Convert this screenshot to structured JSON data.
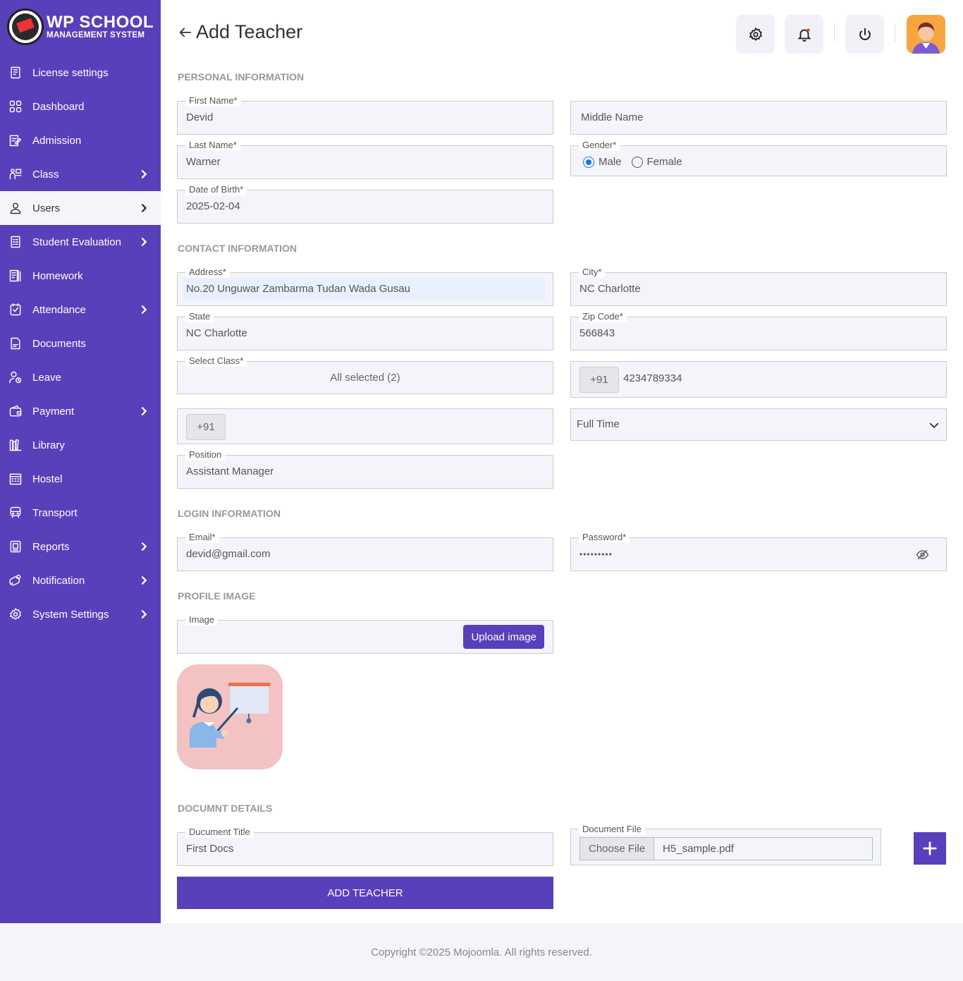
{
  "brand": {
    "title": "WP SCHOOL",
    "subtitle": "MANAGEMENT SYSTEM"
  },
  "sidebar": {
    "items": [
      {
        "label": "License settings",
        "icon": "license-icon",
        "chevron": false
      },
      {
        "label": "Dashboard",
        "icon": "dashboard-icon",
        "chevron": false
      },
      {
        "label": "Admission",
        "icon": "admission-icon",
        "chevron": false
      },
      {
        "label": "Class",
        "icon": "class-icon",
        "chevron": true
      },
      {
        "label": "Users",
        "icon": "user-icon",
        "chevron": true,
        "active": true
      },
      {
        "label": "Student Evaluation",
        "icon": "evaluation-icon",
        "chevron": true
      },
      {
        "label": "Homework",
        "icon": "homework-icon",
        "chevron": false
      },
      {
        "label": "Attendance",
        "icon": "attendance-icon",
        "chevron": true
      },
      {
        "label": "Documents",
        "icon": "documents-icon",
        "chevron": false
      },
      {
        "label": "Leave",
        "icon": "leave-icon",
        "chevron": false
      },
      {
        "label": "Payment",
        "icon": "payment-icon",
        "chevron": true
      },
      {
        "label": "Library",
        "icon": "library-icon",
        "chevron": false
      },
      {
        "label": "Hostel",
        "icon": "hostel-icon",
        "chevron": false
      },
      {
        "label": "Transport",
        "icon": "transport-icon",
        "chevron": false
      },
      {
        "label": "Reports",
        "icon": "reports-icon",
        "chevron": true
      },
      {
        "label": "Notification",
        "icon": "notification-icon",
        "chevron": true
      },
      {
        "label": "System Settings",
        "icon": "settings-icon",
        "chevron": true
      }
    ]
  },
  "header": {
    "title": "Add Teacher"
  },
  "sections": {
    "personal": "PERSONAL INFORMATION",
    "contact": "CONTACT INFORMATION",
    "login": "LOGIN INFORMATION",
    "profile": "PROFILE IMAGE",
    "document": "DOCUMNT DETAILS"
  },
  "form": {
    "first_name": {
      "label": "First Name*",
      "value": "Devid"
    },
    "middle_name": {
      "placeholder": "Middle Name"
    },
    "last_name": {
      "label": "Last Name*",
      "value": "Warner"
    },
    "gender": {
      "label": "Gender*",
      "male": "Male",
      "female": "Female",
      "selected": "Male"
    },
    "dob": {
      "label": "Date of Birth*",
      "value": "2025-02-04"
    },
    "address": {
      "label": "Address*",
      "value": "No.20 Unguwar Zambarma Tudan Wada Gusau"
    },
    "city": {
      "label": "City*",
      "value": "NC Charlotte"
    },
    "state": {
      "label": "State",
      "value": "NC Charlotte"
    },
    "zip": {
      "label": "Zip Code*",
      "value": "566843"
    },
    "select_class": {
      "label": "Select Class*",
      "value": "All selected (2)"
    },
    "mobile": {
      "code": "+91",
      "value": "4234789334"
    },
    "alt_mobile": {
      "code": "+91",
      "value": ""
    },
    "employment": {
      "value": "Full Time"
    },
    "position": {
      "label": "Position",
      "value": "Assistant Manager"
    },
    "email": {
      "label": "Email*",
      "value": "devid@gmail.com"
    },
    "password": {
      "label": "Password*",
      "value": "•••••••••"
    },
    "image": {
      "label": "Image",
      "button": "Upload image"
    },
    "doc_title": {
      "label": "Ducument Title",
      "value": "First Docs"
    },
    "doc_file": {
      "label": "Document File",
      "button": "Choose File",
      "value": "H5_sample.pdf"
    }
  },
  "submit": "ADD TEACHER",
  "footer": "Copyright ©2025 Mojoomla. All rights reserved.",
  "colors": {
    "accent": "#5840bb",
    "field_bg": "#f3f5fa"
  }
}
